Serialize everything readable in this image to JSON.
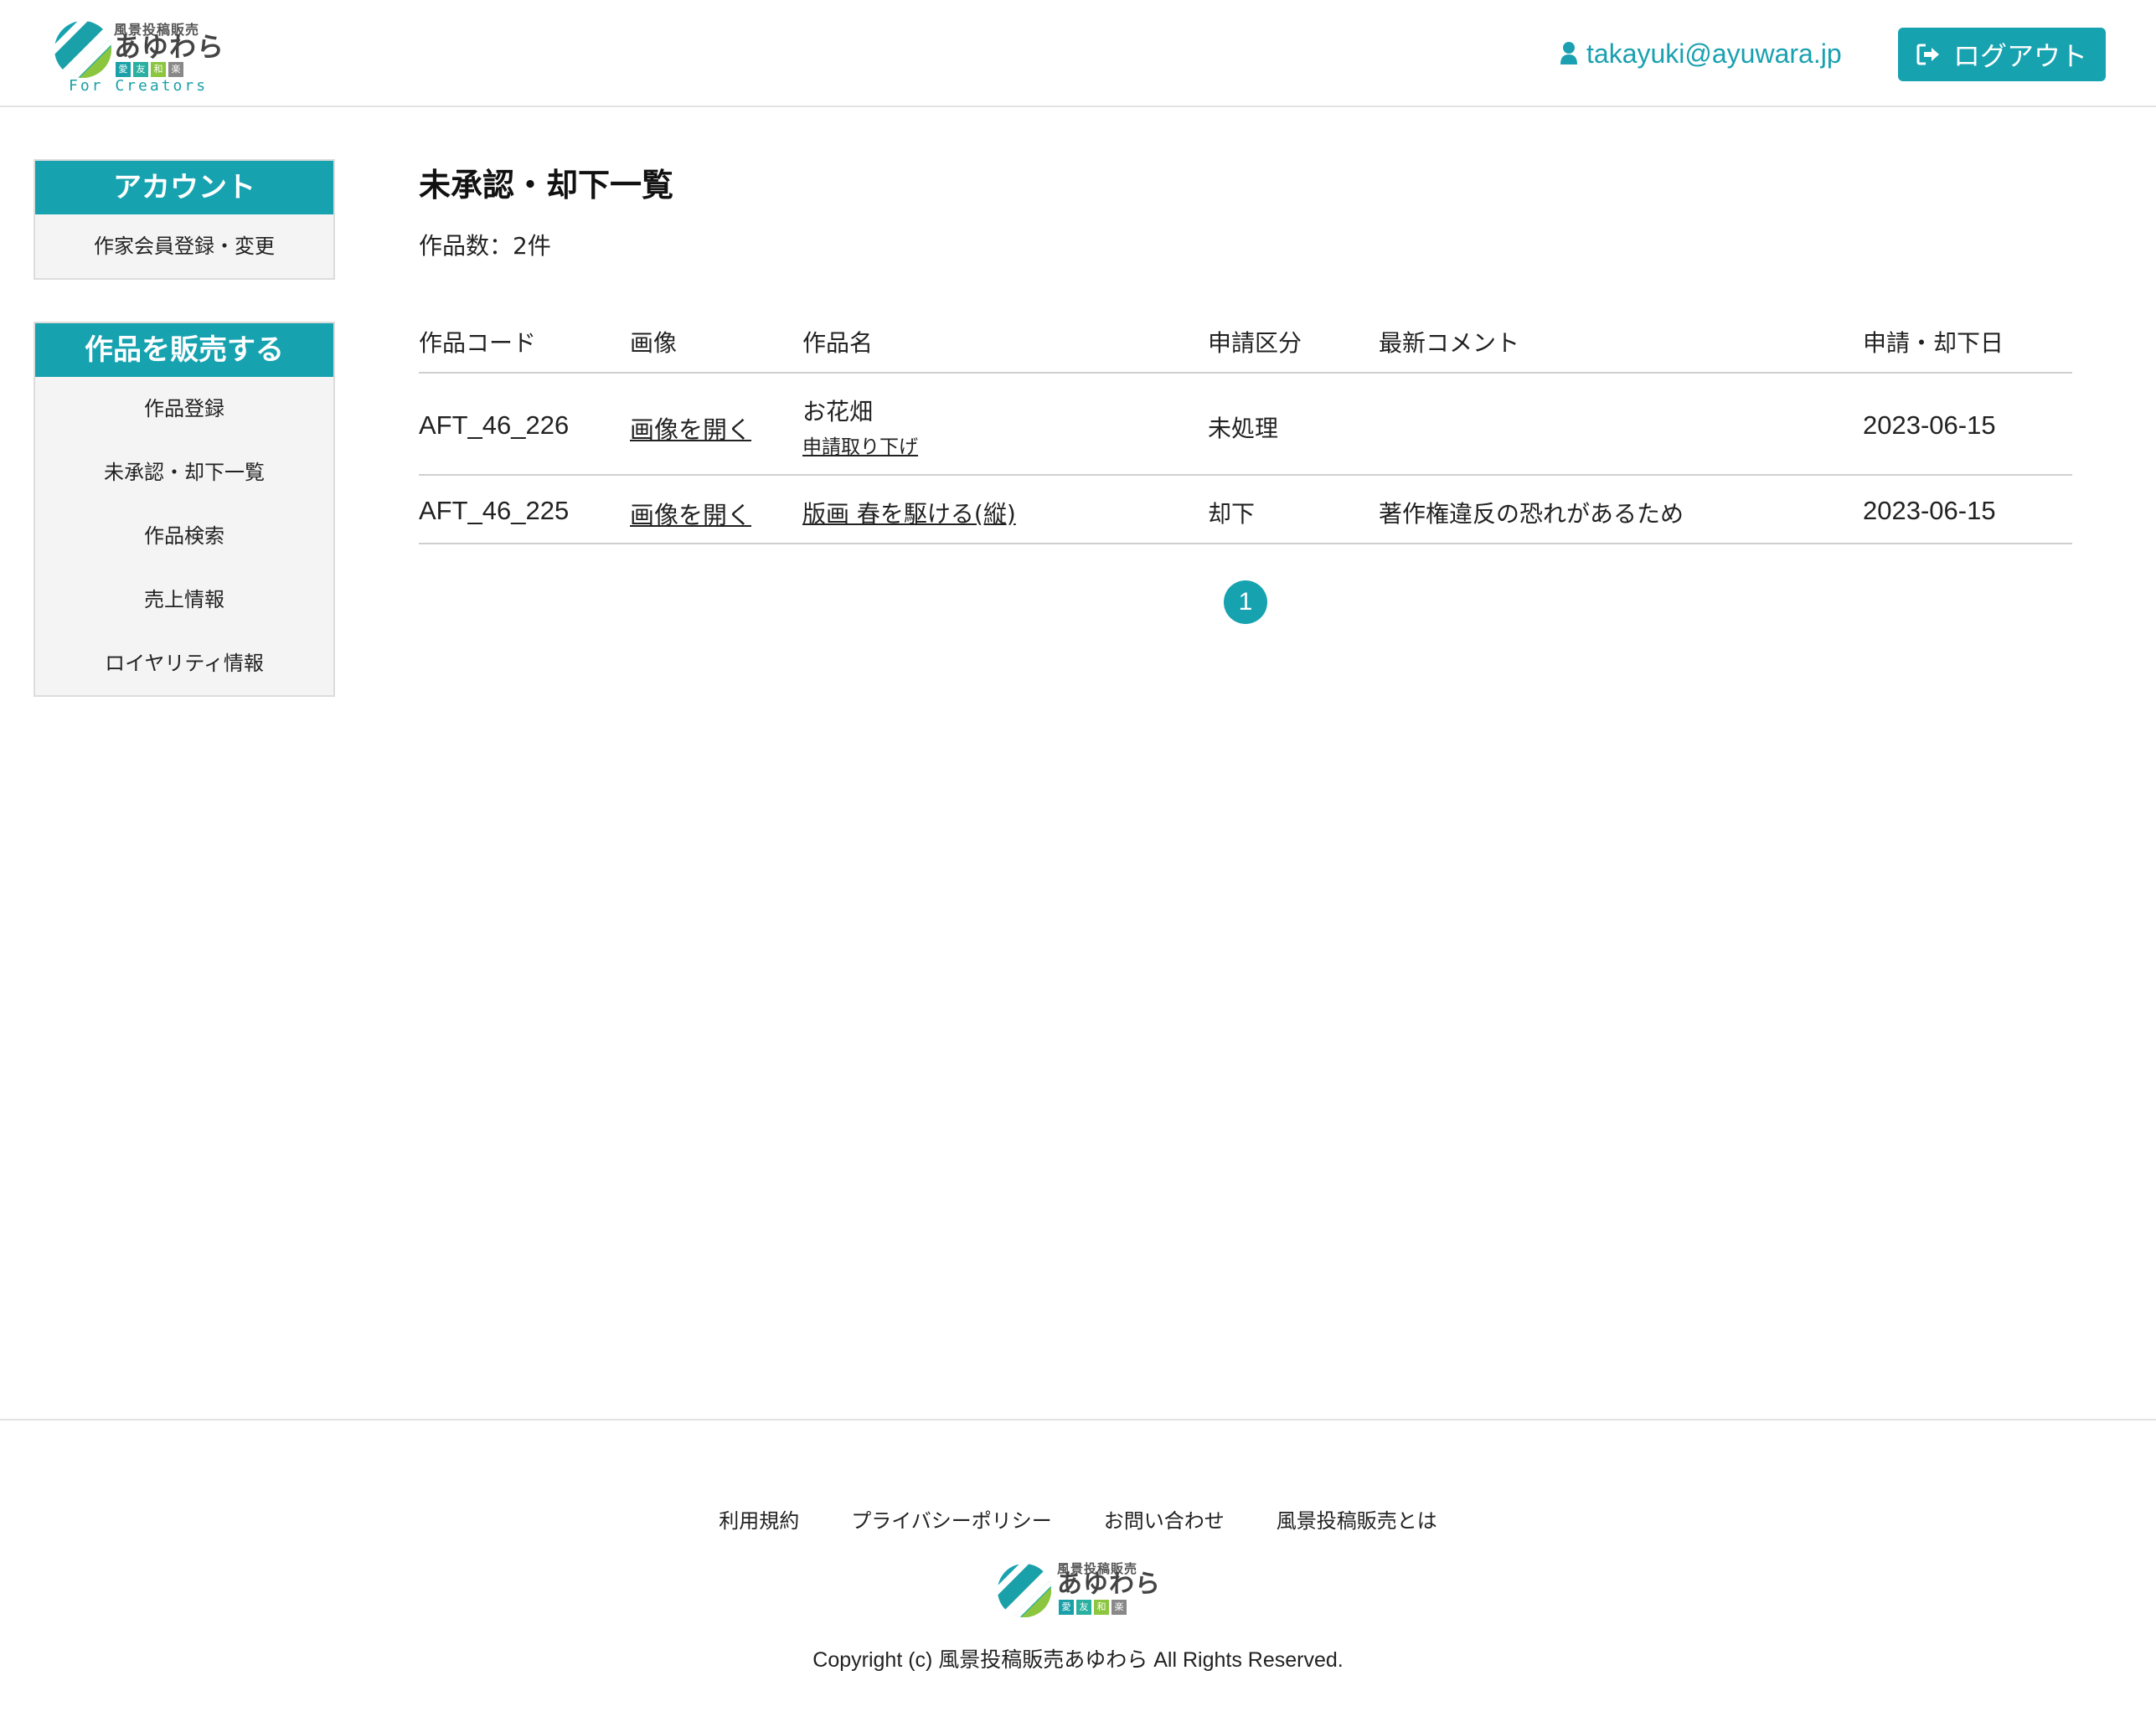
{
  "header": {
    "logo_top": "風景投稿販売",
    "logo_main": "あゆわら",
    "logo_boxes": [
      "愛",
      "友",
      "和",
      "楽"
    ],
    "logo_sub": "For Creators",
    "user_email": "takayuki@ayuwara.jp",
    "user_icon": "user-icon",
    "logout_label": "ログアウト",
    "logout_icon": "sign-out-icon"
  },
  "sidebar": {
    "account": {
      "title": "アカウント",
      "items": [
        {
          "label": "作家会員登録・変更"
        }
      ]
    },
    "sell": {
      "title": "作品を販売する",
      "items": [
        {
          "label": "作品登録"
        },
        {
          "label": "未承認・却下一覧"
        },
        {
          "label": "作品検索"
        },
        {
          "label": "売上情報"
        },
        {
          "label": "ロイヤリティ情報"
        }
      ]
    }
  },
  "main": {
    "title": "未承認・却下一覧",
    "count_text": "作品数：2件",
    "columns": [
      "作品コード",
      "画像",
      "作品名",
      "申請区分",
      "最新コメント",
      "申請・却下日"
    ],
    "rows": [
      {
        "code": "AFT_46_226",
        "image_link": "画像を開く",
        "name": "お花畑",
        "withdraw_link": "申請取り下げ",
        "status": "未処理",
        "comment": "",
        "date": "2023-06-15"
      },
      {
        "code": "AFT_46_225",
        "image_link": "画像を開く",
        "name": "版画 春を駆ける(縦)",
        "status": "却下",
        "comment": "著作権違反の恐れがあるため",
        "date": "2023-06-15"
      }
    ],
    "pagination": {
      "current": "1"
    }
  },
  "footer": {
    "links": [
      "利用規約",
      "プライバシーポリシー",
      "お問い合わせ",
      "風景投稿販売とは"
    ],
    "copyright": "Copyright (c) 風景投稿販売あゆわら All Rights Reserved."
  },
  "colors": {
    "accent": "#17a2b0",
    "logo_green": "#8cc63f",
    "logo_teal": "#1aa0a8",
    "box_colors": [
      "#1aa0a8",
      "#2ab0a0",
      "#8cc63f",
      "#888888"
    ]
  }
}
